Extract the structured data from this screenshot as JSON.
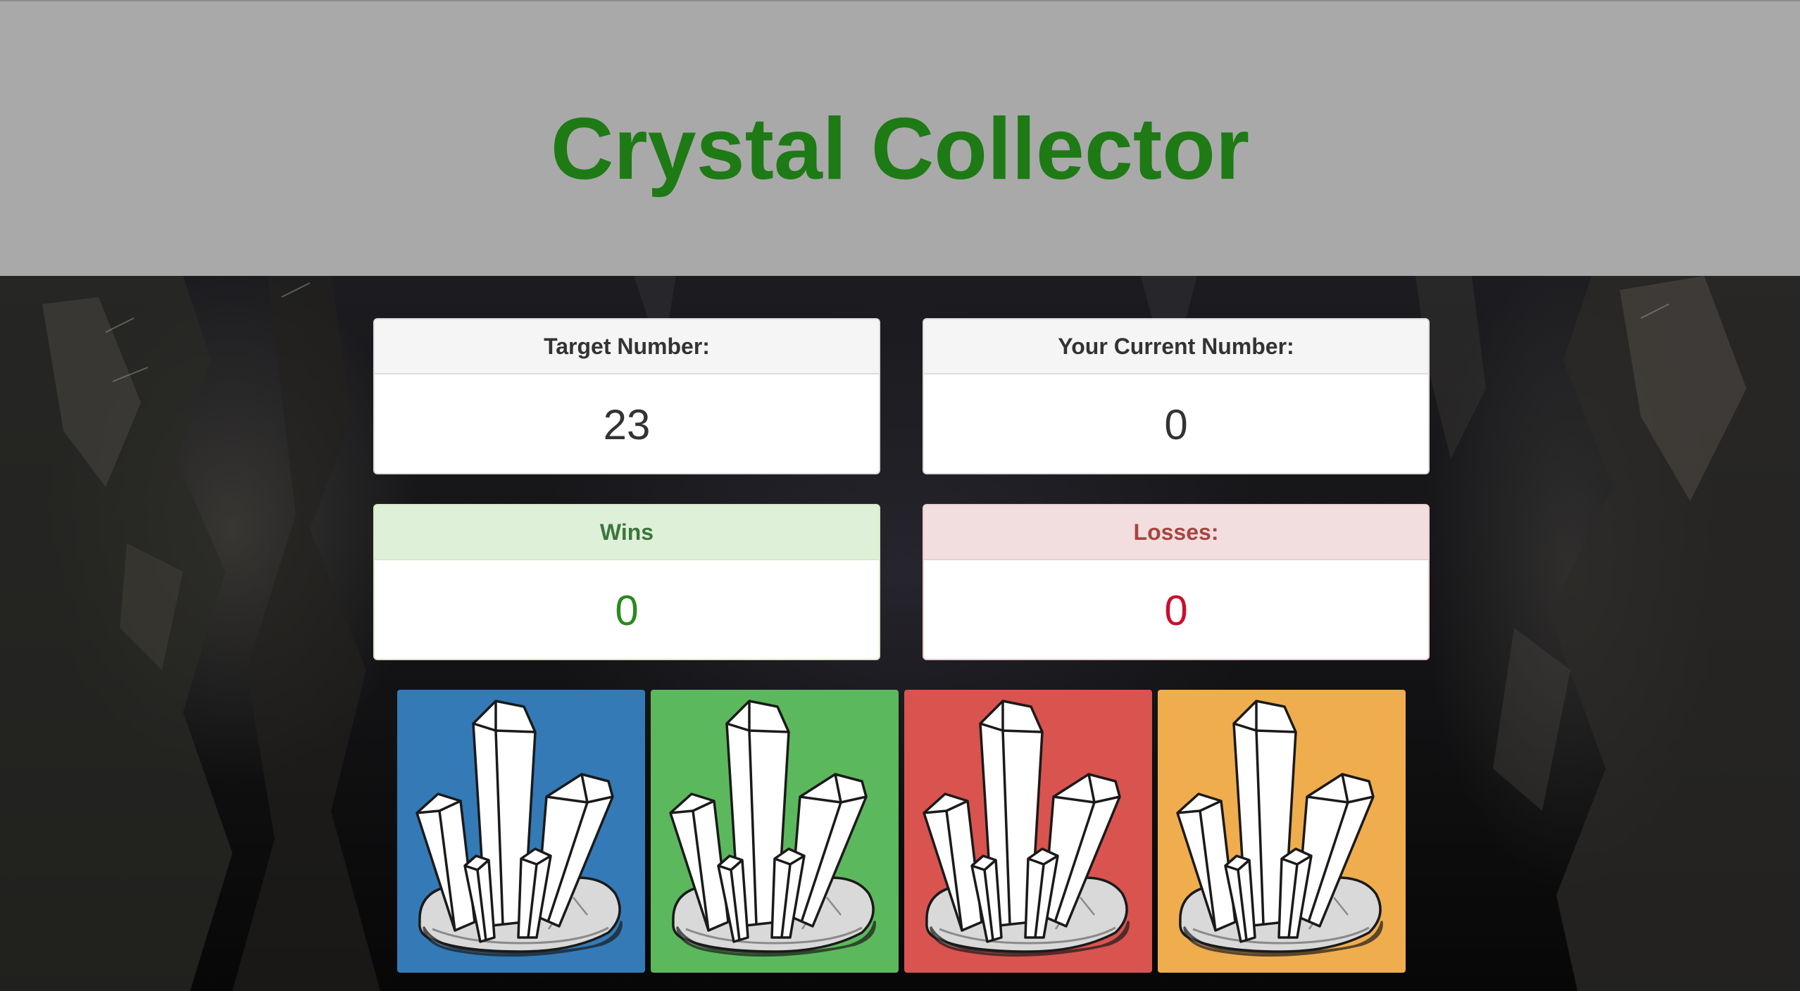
{
  "header": {
    "title": "Crystal Collector",
    "title_color": "#1e7a14",
    "background": "#a9a9a9"
  },
  "scoreboard": {
    "target": {
      "label": "Target Number:",
      "value": "23"
    },
    "current": {
      "label": "Your Current Number:",
      "value": "0"
    },
    "wins": {
      "label": "Wins",
      "value": "0",
      "color": "#3c763d"
    },
    "losses": {
      "label": "Losses:",
      "value": "0",
      "color": "#a94442"
    }
  },
  "crystals": [
    {
      "name": "blue",
      "color": "#337ab7",
      "icon": "crystal-cluster-icon"
    },
    {
      "name": "green",
      "color": "#5cb85c",
      "icon": "crystal-cluster-icon"
    },
    {
      "name": "red",
      "color": "#d9534f",
      "icon": "crystal-cluster-icon"
    },
    {
      "name": "orange",
      "color": "#f0ad4e",
      "icon": "crystal-cluster-icon"
    }
  ]
}
